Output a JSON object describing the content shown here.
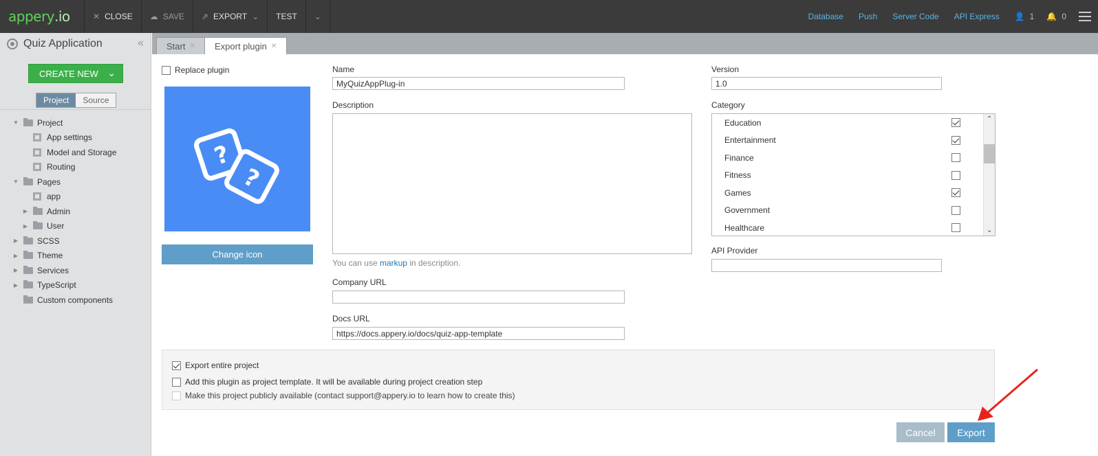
{
  "topbar": {
    "logo_main": "appery",
    "logo_suffix": ".io",
    "close": "CLOSE",
    "save": "SAVE",
    "export": "EXPORT",
    "test": "TEST",
    "links": [
      "Database",
      "Push",
      "Server Code",
      "API Express"
    ],
    "users_count": "1",
    "notifications_count": "0"
  },
  "sidebar": {
    "title": "Quiz Application",
    "create_new": "CREATE NEW",
    "seg_project": "Project",
    "seg_source": "Source",
    "tree": [
      {
        "label": "Project",
        "level": 0,
        "type": "folder",
        "arrow": "open"
      },
      {
        "label": "App settings",
        "level": 1,
        "type": "file",
        "arrow": "none"
      },
      {
        "label": "Model and Storage",
        "level": 1,
        "type": "file",
        "arrow": "none"
      },
      {
        "label": "Routing",
        "level": 1,
        "type": "file",
        "arrow": "none"
      },
      {
        "label": "Pages",
        "level": 0,
        "type": "folder",
        "arrow": "open"
      },
      {
        "label": "app",
        "level": 1,
        "type": "file",
        "arrow": "none"
      },
      {
        "label": "Admin",
        "level": 1,
        "type": "folder",
        "arrow": "closed"
      },
      {
        "label": "User",
        "level": 1,
        "type": "folder",
        "arrow": "closed"
      },
      {
        "label": "SCSS",
        "level": 0,
        "type": "folder",
        "arrow": "closed"
      },
      {
        "label": "Theme",
        "level": 0,
        "type": "folder",
        "arrow": "closed"
      },
      {
        "label": "Services",
        "level": 0,
        "type": "folder",
        "arrow": "closed"
      },
      {
        "label": "TypeScript",
        "level": 0,
        "type": "folder",
        "arrow": "closed"
      },
      {
        "label": "Custom components",
        "level": 0,
        "type": "folder",
        "arrow": "none"
      }
    ]
  },
  "tabs": [
    {
      "label": "Start",
      "active": false
    },
    {
      "label": "Export plugin",
      "active": true
    }
  ],
  "form": {
    "replace_plugin": "Replace plugin",
    "change_icon": "Change icon",
    "name_label": "Name",
    "name_value": "MyQuizAppPlug-in",
    "description_label": "Description",
    "desc_hint_pre": "You can use",
    "desc_hint_link": "markup",
    "desc_hint_post": "in description.",
    "company_url_label": "Company URL",
    "company_url_value": "",
    "docs_url_label": "Docs URL",
    "docs_url_value": "https://docs.appery.io/docs/quiz-app-template",
    "version_label": "Version",
    "version_value": "1.0",
    "category_label": "Category",
    "categories": [
      {
        "label": "Education",
        "checked": true
      },
      {
        "label": "Entertainment",
        "checked": true
      },
      {
        "label": "Finance",
        "checked": false
      },
      {
        "label": "Fitness",
        "checked": false
      },
      {
        "label": "Games",
        "checked": true
      },
      {
        "label": "Government",
        "checked": false
      },
      {
        "label": "Healthcare",
        "checked": false
      }
    ],
    "api_provider_label": "API Provider",
    "api_provider_value": ""
  },
  "options": {
    "export_entire": "Export entire project",
    "add_template": "Add this plugin as project template. It will be available during project creation step",
    "make_public": "Make this project publicly available (contact support@appery.io to learn how to create this)"
  },
  "buttons": {
    "cancel": "Cancel",
    "export": "Export"
  },
  "colors": {
    "accent_blue": "#5f9ec9",
    "create_green": "#3bb04a",
    "icon_bg": "#4a8cf5",
    "link": "#1a7ab8",
    "annotation_arrow": "#e8231d"
  }
}
